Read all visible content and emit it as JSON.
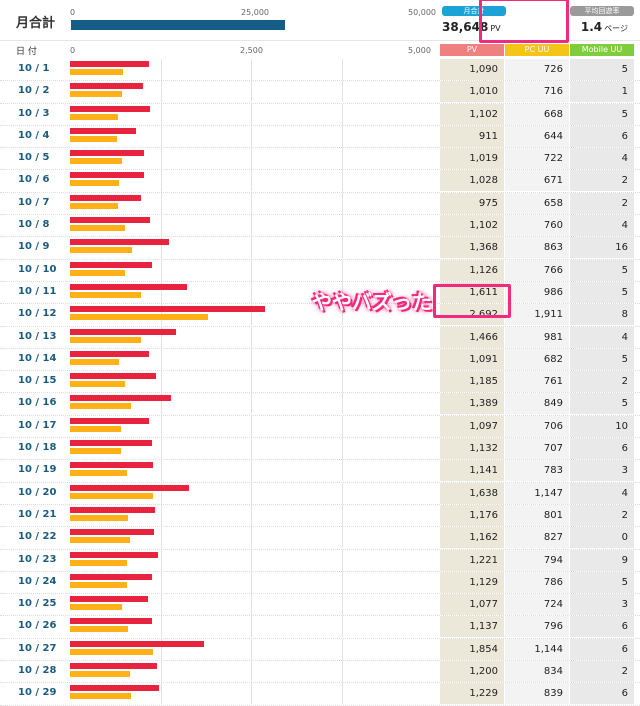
{
  "header": {
    "title": "月合計",
    "scale_ticks": [
      "0",
      "25,000",
      "50,000"
    ],
    "month_total_label": "月合計",
    "month_total_value": "38,648",
    "month_total_unit": "PV",
    "avg_label": "平均回遊率",
    "avg_value": "1.4",
    "avg_unit": "ページ",
    "month_total_numeric": 38648,
    "scale_max": 50000
  },
  "table": {
    "date_header": "日 付",
    "scale_ticks": [
      "0",
      "2,500",
      "5,000"
    ],
    "scale_max": 5000,
    "col_pv": "PV",
    "col_pc": "PC UU",
    "col_mobile": "Mobile UU",
    "rows": [
      {
        "date": "10 / 1",
        "pv": "1,090",
        "pc": "726",
        "mb": "5",
        "pvn": 1090,
        "pcn": 726
      },
      {
        "date": "10 / 2",
        "pv": "1,010",
        "pc": "716",
        "mb": "1",
        "pvn": 1010,
        "pcn": 716
      },
      {
        "date": "10 / 3",
        "pv": "1,102",
        "pc": "668",
        "mb": "5",
        "pvn": 1102,
        "pcn": 668
      },
      {
        "date": "10 / 4",
        "pv": "911",
        "pc": "644",
        "mb": "6",
        "pvn": 911,
        "pcn": 644
      },
      {
        "date": "10 / 5",
        "pv": "1,019",
        "pc": "722",
        "mb": "4",
        "pvn": 1019,
        "pcn": 722
      },
      {
        "date": "10 / 6",
        "pv": "1,028",
        "pc": "671",
        "mb": "2",
        "pvn": 1028,
        "pcn": 671
      },
      {
        "date": "10 / 7",
        "pv": "975",
        "pc": "658",
        "mb": "2",
        "pvn": 975,
        "pcn": 658
      },
      {
        "date": "10 / 8",
        "pv": "1,102",
        "pc": "760",
        "mb": "4",
        "pvn": 1102,
        "pcn": 760
      },
      {
        "date": "10 / 9",
        "pv": "1,368",
        "pc": "863",
        "mb": "16",
        "pvn": 1368,
        "pcn": 863
      },
      {
        "date": "10 / 10",
        "pv": "1,126",
        "pc": "766",
        "mb": "5",
        "pvn": 1126,
        "pcn": 766
      },
      {
        "date": "10 / 11",
        "pv": "1,611",
        "pc": "986",
        "mb": "5",
        "pvn": 1611,
        "pcn": 986
      },
      {
        "date": "10 / 12",
        "pv": "2,692",
        "pc": "1,911",
        "mb": "8",
        "pvn": 2692,
        "pcn": 1911
      },
      {
        "date": "10 / 13",
        "pv": "1,466",
        "pc": "981",
        "mb": "4",
        "pvn": 1466,
        "pcn": 981
      },
      {
        "date": "10 / 14",
        "pv": "1,091",
        "pc": "682",
        "mb": "5",
        "pvn": 1091,
        "pcn": 682
      },
      {
        "date": "10 / 15",
        "pv": "1,185",
        "pc": "761",
        "mb": "2",
        "pvn": 1185,
        "pcn": 761
      },
      {
        "date": "10 / 16",
        "pv": "1,389",
        "pc": "849",
        "mb": "5",
        "pvn": 1389,
        "pcn": 849
      },
      {
        "date": "10 / 17",
        "pv": "1,097",
        "pc": "706",
        "mb": "10",
        "pvn": 1097,
        "pcn": 706
      },
      {
        "date": "10 / 18",
        "pv": "1,132",
        "pc": "707",
        "mb": "6",
        "pvn": 1132,
        "pcn": 707
      },
      {
        "date": "10 / 19",
        "pv": "1,141",
        "pc": "783",
        "mb": "3",
        "pvn": 1141,
        "pcn": 783
      },
      {
        "date": "10 / 20",
        "pv": "1,638",
        "pc": "1,147",
        "mb": "4",
        "pvn": 1638,
        "pcn": 1147
      },
      {
        "date": "10 / 21",
        "pv": "1,176",
        "pc": "801",
        "mb": "2",
        "pvn": 1176,
        "pcn": 801
      },
      {
        "date": "10 / 22",
        "pv": "1,162",
        "pc": "827",
        "mb": "0",
        "pvn": 1162,
        "pcn": 827
      },
      {
        "date": "10 / 23",
        "pv": "1,221",
        "pc": "794",
        "mb": "9",
        "pvn": 1221,
        "pcn": 794
      },
      {
        "date": "10 / 24",
        "pv": "1,129",
        "pc": "786",
        "mb": "5",
        "pvn": 1129,
        "pcn": 786
      },
      {
        "date": "10 / 25",
        "pv": "1,077",
        "pc": "724",
        "mb": "3",
        "pvn": 1077,
        "pcn": 724
      },
      {
        "date": "10 / 26",
        "pv": "1,137",
        "pc": "796",
        "mb": "6",
        "pvn": 1137,
        "pcn": 796
      },
      {
        "date": "10 / 27",
        "pv": "1,854",
        "pc": "1,144",
        "mb": "6",
        "pvn": 1854,
        "pcn": 1144
      },
      {
        "date": "10 / 28",
        "pv": "1,200",
        "pc": "834",
        "mb": "2",
        "pvn": 1200,
        "pcn": 834
      },
      {
        "date": "10 / 29",
        "pv": "1,229",
        "pc": "839",
        "mb": "6",
        "pvn": 1229,
        "pcn": 839
      }
    ]
  },
  "annotation": {
    "text": "ややバズった"
  },
  "colors": {
    "pv_bar": "#e8233d",
    "pc_bar": "#ffb117",
    "pv_head": "#f07f7f",
    "pc_head": "#f3c517",
    "mobile_head": "#7fcd3c",
    "month_head": "#1ba3d8",
    "avg_head": "#9a9a9a",
    "highlight": "#f22a7d"
  }
}
